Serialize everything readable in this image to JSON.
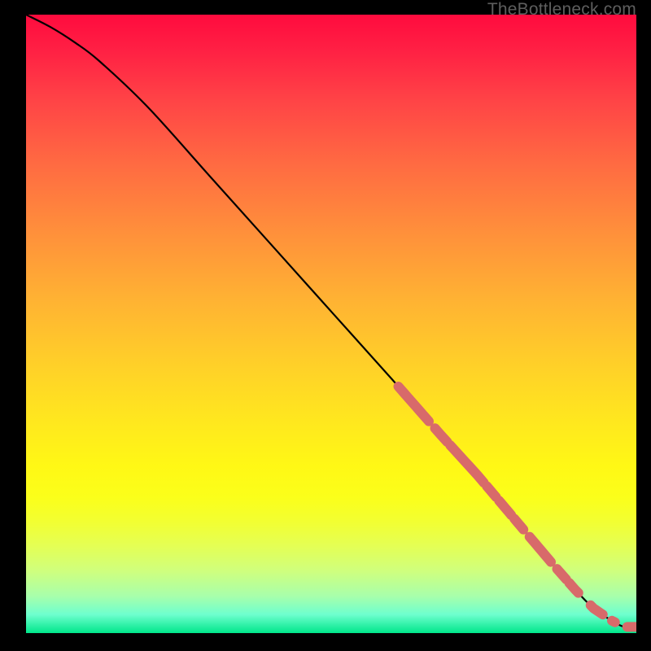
{
  "watermark": "TheBottleneck.com",
  "chart_data": {
    "type": "line",
    "title": "",
    "xlabel": "",
    "ylabel": "",
    "xlim": [
      0,
      100
    ],
    "ylim": [
      0,
      100
    ],
    "series": [
      {
        "name": "curve",
        "x": [
          0,
          4,
          8,
          12,
          20,
          30,
          40,
          50,
          60,
          68,
          74,
          80,
          86,
          90,
          93,
          96,
          98,
          100
        ],
        "values": [
          100,
          98,
          95.5,
          92.5,
          85,
          74,
          63,
          52,
          41,
          32,
          25.5,
          18.5,
          11.5,
          7,
          4,
          2,
          1,
          1
        ]
      }
    ],
    "markers": {
      "name": "highlight-segments",
      "color": "#d86a6a",
      "segments_x": [
        [
          61,
          66
        ],
        [
          67,
          69
        ],
        [
          69.5,
          75
        ],
        [
          75.5,
          77
        ],
        [
          77.5,
          79.5
        ],
        [
          80,
          81.5
        ],
        [
          82.5,
          86
        ],
        [
          87,
          88.5
        ],
        [
          89,
          90.5
        ],
        [
          92.5,
          94.5
        ],
        [
          96,
          96.5
        ],
        [
          98.5,
          100
        ]
      ]
    },
    "gradient_stops": [
      {
        "pos": 0,
        "color": "#ff0b3e"
      },
      {
        "pos": 35,
        "color": "#ff8f3b"
      },
      {
        "pos": 66,
        "color": "#ffe81e"
      },
      {
        "pos": 100,
        "color": "#00e68a"
      }
    ]
  }
}
